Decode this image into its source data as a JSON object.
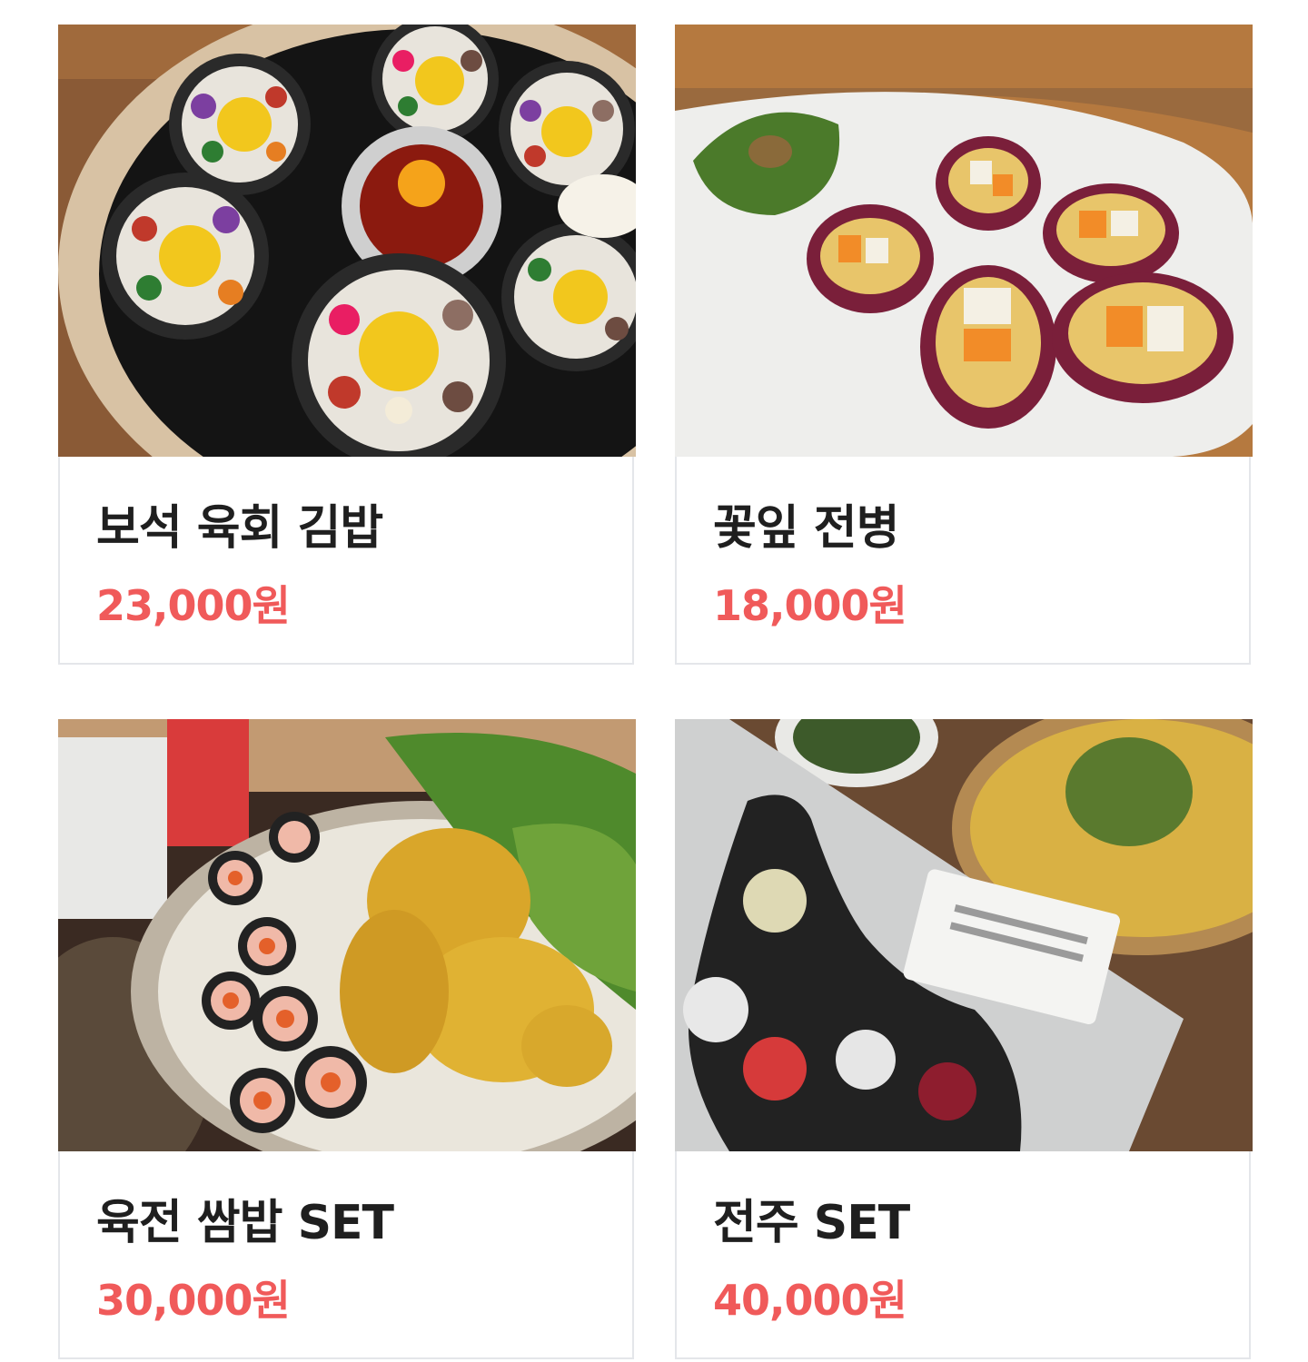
{
  "menu": {
    "items": [
      {
        "name": "보석 육회 김밥",
        "price": "23,000원",
        "image": "jewel-yukhoe-kimbap-photo"
      },
      {
        "name": "꽃잎 전병",
        "price": "18,000원",
        "image": "petal-jeonbyeong-photo"
      },
      {
        "name": "육전 쌈밥 SET",
        "price": "30,000원",
        "image": "yukjeon-ssambap-set-photo"
      },
      {
        "name": "전주 SET",
        "price": "40,000원",
        "image": "jeonju-set-photo"
      }
    ]
  },
  "colors": {
    "price": "#f05a5a",
    "name": "#1f1f1f",
    "border": "#e4e6ea"
  }
}
